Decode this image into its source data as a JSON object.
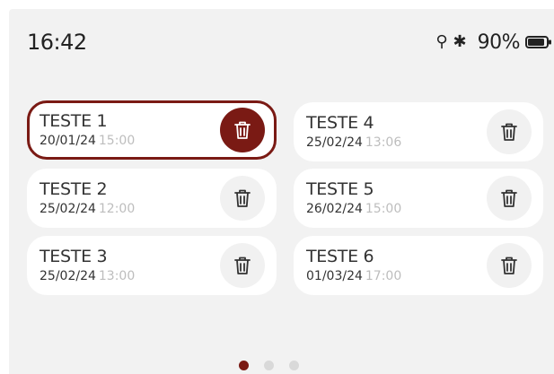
{
  "status_bar": {
    "time": "16:42",
    "usb_icon": "usb-icon",
    "bluetooth_icon": "bluetooth-icon",
    "battery_percent": "90%",
    "battery_level": 0.9
  },
  "colors": {
    "accent": "#7a1a14",
    "background": "#f2f2f2",
    "card": "#ffffff",
    "muted_time": "#bdbdbd"
  },
  "items": [
    {
      "title": "TESTE 1",
      "date": "20/01/24",
      "time": "15:00",
      "selected": true
    },
    {
      "title": "TESTE 2",
      "date": "25/02/24",
      "time": "12:00",
      "selected": false
    },
    {
      "title": "TESTE 3",
      "date": "25/02/24",
      "time": "13:00",
      "selected": false
    },
    {
      "title": "TESTE 4",
      "date": "25/02/24",
      "time": "13:06",
      "selected": false
    },
    {
      "title": "TESTE 5",
      "date": "26/02/24",
      "time": "15:00",
      "selected": false
    },
    {
      "title": "TESTE 6",
      "date": "01/03/24",
      "time": "17:00",
      "selected": false
    }
  ],
  "pagination": {
    "pages": 3,
    "current": 1
  }
}
